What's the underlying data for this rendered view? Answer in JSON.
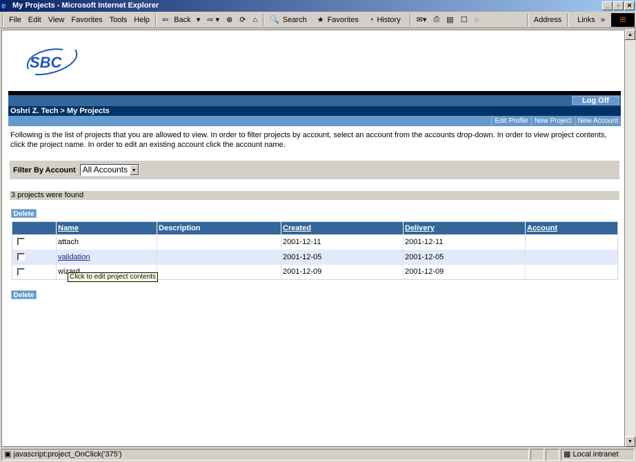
{
  "window": {
    "title": "My Projects - Microsoft Internet Explorer"
  },
  "menu": [
    "File",
    "Edit",
    "View",
    "Favorites",
    "Tools",
    "Help"
  ],
  "toolbar": {
    "back": "Back",
    "search": "Search",
    "favorites": "Favorites",
    "history": "History",
    "address": "Address",
    "links": "Links"
  },
  "logo": {
    "text": "SBC"
  },
  "header": {
    "logoff": "Log Off",
    "breadcrumb": "Oshri Z. Tech > My Projects",
    "links": [
      "Edit Profile",
      "New Project",
      "New Account"
    ]
  },
  "description": "Following is the list of projects that you are allowed to view. In order to filter projects by account, select an account from the accounts drop-down. In order to view project contents, click the project name. In order to edit an existing account click the account name.",
  "filter": {
    "label": "Filter By Account",
    "selected": "All Accounts"
  },
  "found": "3 projects were found",
  "delete_label": "Delete",
  "table": {
    "headers": [
      "Name",
      "Description",
      "Created",
      "Delivery",
      "Account"
    ],
    "rows": [
      {
        "name": "attach",
        "description": "",
        "created": "2001-12-11",
        "delivery": "2001-12-11",
        "account": ""
      },
      {
        "name": "validation",
        "description": "",
        "created": "2001-12-05",
        "delivery": "2001-12-05",
        "account": ""
      },
      {
        "name": "wizard",
        "description": "",
        "created": "2001-12-09",
        "delivery": "2001-12-09",
        "account": ""
      }
    ]
  },
  "tooltip": "Click to edit project contents",
  "status": {
    "text": "javascript:project_OnClick('375')",
    "zone": "Local intranet"
  }
}
